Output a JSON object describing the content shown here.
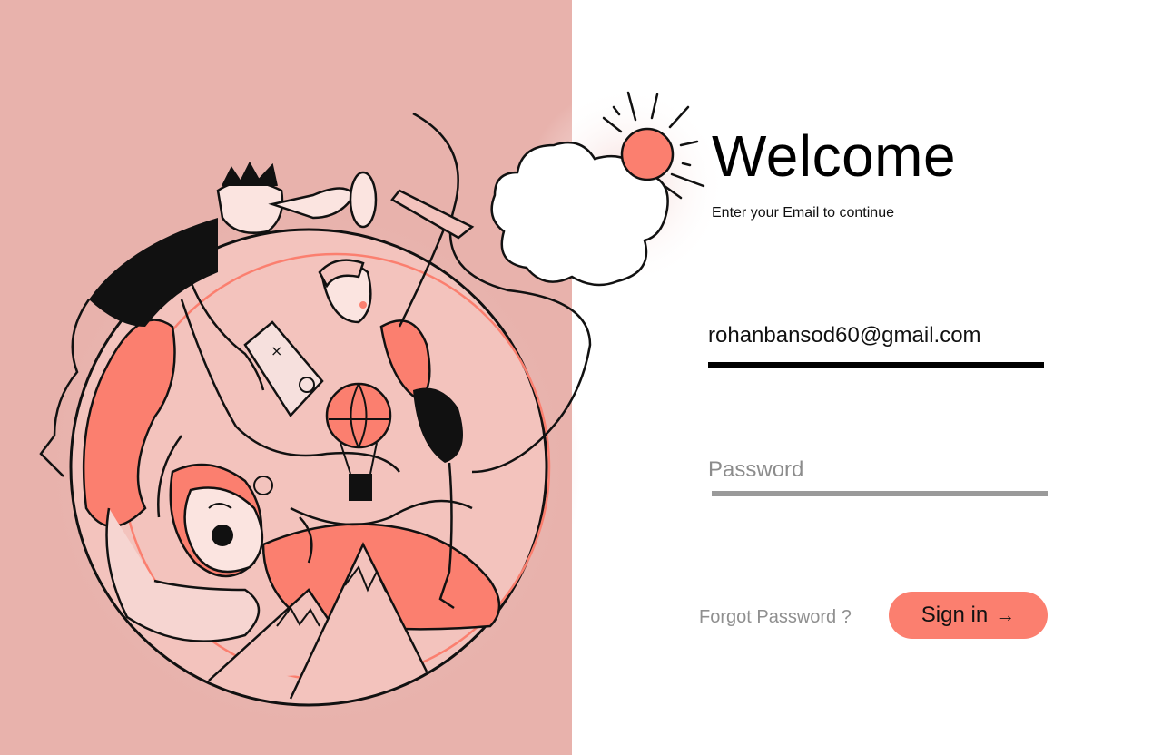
{
  "header": {
    "title": "Welcome",
    "subtitle": "Enter your Email to continue"
  },
  "form": {
    "email_value": "rohanbansod60@gmail.com",
    "password_placeholder": "Password",
    "forgot_label": "Forgot Password ?",
    "signin_label": "Sign in",
    "signin_icon": "arrow-right-icon"
  },
  "colors": {
    "left_panel_bg": "#e8b2ac",
    "accent": "#fb7f6f",
    "text": "#000000",
    "muted": "#8f8f8f"
  }
}
